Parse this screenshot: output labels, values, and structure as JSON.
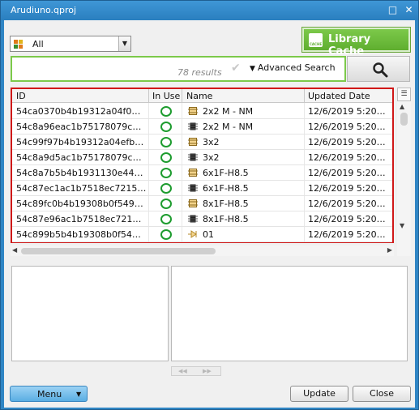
{
  "window": {
    "title": "Arudiuno.qproj",
    "maximize_icon": "maximize-icon",
    "close_icon": "close-icon"
  },
  "toolbar": {
    "category": {
      "selected": "All",
      "icon": "category-grid-icon"
    },
    "library_cache": {
      "label": "Library Cache",
      "icon_text": "CACHE"
    },
    "search": {
      "results": "78 results",
      "advanced_label": "Advanced Search",
      "search_icon": "magnifier-icon"
    }
  },
  "grid": {
    "columns": [
      "ID",
      "In Use",
      "Name",
      "Updated Date"
    ],
    "rows": [
      {
        "id": "54ca0370b4b19312a04f0…",
        "name": "2x2 M - NM",
        "date": "12/6/2019 5:20…",
        "icon": "footprint"
      },
      {
        "id": "54c8a96eac1b75178079c…",
        "name": "2x2 M - NM",
        "date": "12/6/2019 5:20…",
        "icon": "chip"
      },
      {
        "id": "54c99f97b4b19312a04efb…",
        "name": "3x2",
        "date": "12/6/2019 5:20…",
        "icon": "footprint"
      },
      {
        "id": "54c8a9d5ac1b75178079c…",
        "name": "3x2",
        "date": "12/6/2019 5:20…",
        "icon": "chip"
      },
      {
        "id": "54c8a7b5b4b1931130e44…",
        "name": "6x1F-H8.5",
        "date": "12/6/2019 5:20…",
        "icon": "footprint"
      },
      {
        "id": "54c87ec1ac1b7518ec7215…",
        "name": "6x1F-H8.5",
        "date": "12/6/2019 5:20…",
        "icon": "chip"
      },
      {
        "id": "54c89fc0b4b19308b0f549…",
        "name": "8x1F-H8.5",
        "date": "12/6/2019 5:20…",
        "icon": "footprint"
      },
      {
        "id": "54c87e96ac1b7518ec721…",
        "name": "8x1F-H8.5",
        "date": "12/6/2019 5:20…",
        "icon": "chip"
      },
      {
        "id": "54c899b5b4b19308b0f54…",
        "name": "01",
        "date": "12/6/2019 5:20…",
        "icon": "symbol"
      }
    ]
  },
  "footer": {
    "menu_label": "Menu",
    "update_label": "Update",
    "close_label": "Close"
  },
  "colors": {
    "accent": "#2f85c4",
    "cache_green": "#5fae2f",
    "selection_red": "#d01818",
    "in_use_green": "#1e9c2f"
  }
}
